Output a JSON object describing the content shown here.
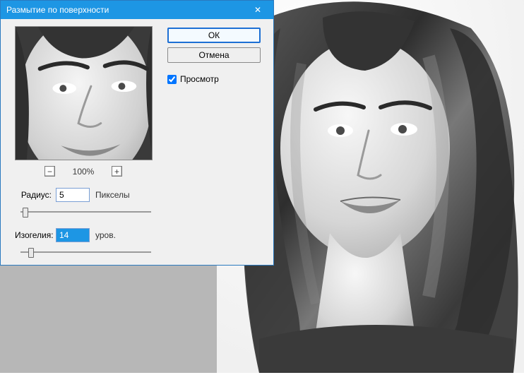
{
  "dialog": {
    "title": "Размытие по поверхности",
    "close_glyph": "✕",
    "ok_label": "ОК",
    "cancel_label": "Отмена",
    "preview_label": "Просмотр",
    "preview_checked": true,
    "zoom": {
      "minus_glyph": "−",
      "plus_glyph": "+",
      "value": "100%"
    },
    "radius": {
      "label": "Радиус:",
      "value": "5",
      "suffix": "Пикселы",
      "slider_percent": 4
    },
    "threshold": {
      "label": "Изогелия:",
      "value": "14",
      "suffix": "уров.",
      "slider_percent": 8
    }
  }
}
